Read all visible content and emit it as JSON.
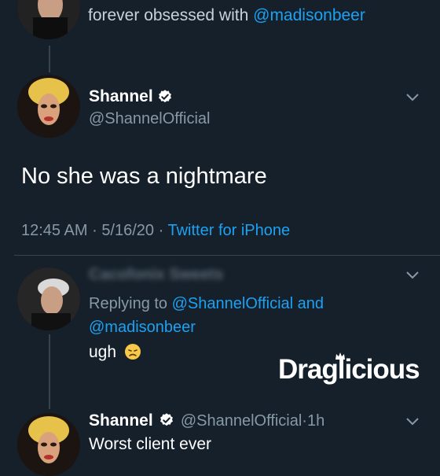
{
  "tweet_prev": {
    "text_prefix": "forever obsessed with",
    "mention": "@madisonbeer"
  },
  "main_tweet": {
    "display_name": "Shannel",
    "handle": "@ShannelOfficial",
    "body": "No she was a nightmare",
    "time": "12:45 AM",
    "date": "5/16/20",
    "source": "Twitter for iPhone",
    "sep": "·"
  },
  "reply1": {
    "name_blurred": "Cacofonix Sweets",
    "replying_to_label": "Replying to",
    "mention1": "@ShannelOfficial",
    "and_label": "and",
    "mention2": "@madisonbeer",
    "body": "ugh",
    "emoji": "😞"
  },
  "reply2": {
    "display_name": "Shannel",
    "handle": "@ShannelOfficial",
    "time": "1h",
    "sep": "·",
    "body": "Worst client ever"
  },
  "watermark": {
    "part1": "Drag",
    "part2": "licious"
  },
  "colors": {
    "background": "#15202b",
    "link": "#1da1f2",
    "muted": "#8899a6",
    "verified": "#ffffff"
  }
}
